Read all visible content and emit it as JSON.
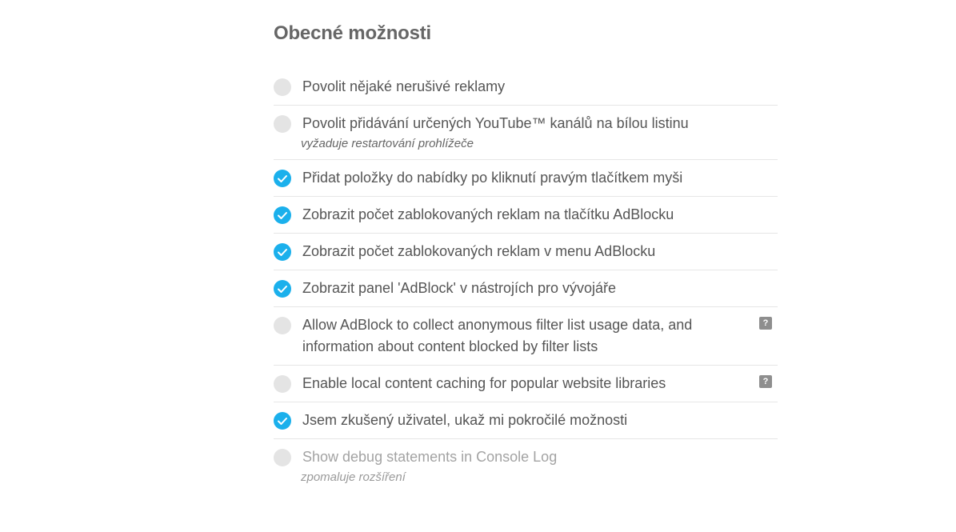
{
  "section": {
    "title": "Obecné možnosti"
  },
  "accent_color": "#1bb0ec",
  "options": [
    {
      "label": "Povolit nějaké nerušivé reklamy",
      "checked": false
    },
    {
      "label": "Povolit přidávání určených YouTube™ kanálů na bílou listinu",
      "note": "vyžaduje restartování prohlížeče",
      "checked": false
    },
    {
      "label": "Přidat položky do nabídky po kliknutí pravým tlačítkem myši",
      "checked": true
    },
    {
      "label": "Zobrazit počet zablokovaných reklam na tlačítku AdBlocku",
      "checked": true
    },
    {
      "label": "Zobrazit počet zablokovaných reklam v menu AdBlocku",
      "checked": true
    },
    {
      "label": "Zobrazit panel 'AdBlock' v nástrojích pro vývojáře",
      "checked": true
    },
    {
      "label": "Allow AdBlock to collect anonymous filter list usage data, and information about content blocked by filter lists",
      "checked": false,
      "help_icon": "question-icon",
      "help_text": "?"
    },
    {
      "label": "Enable local content caching for popular website libraries",
      "checked": false,
      "help_icon": "question-icon",
      "help_text": "?"
    },
    {
      "label": "Jsem zkušený uživatel, ukaž mi pokročilé možnosti",
      "checked": true
    },
    {
      "label": "Show debug statements in Console Log",
      "note": "zpomaluje rozšíření",
      "checked": false,
      "disabled": true
    }
  ]
}
